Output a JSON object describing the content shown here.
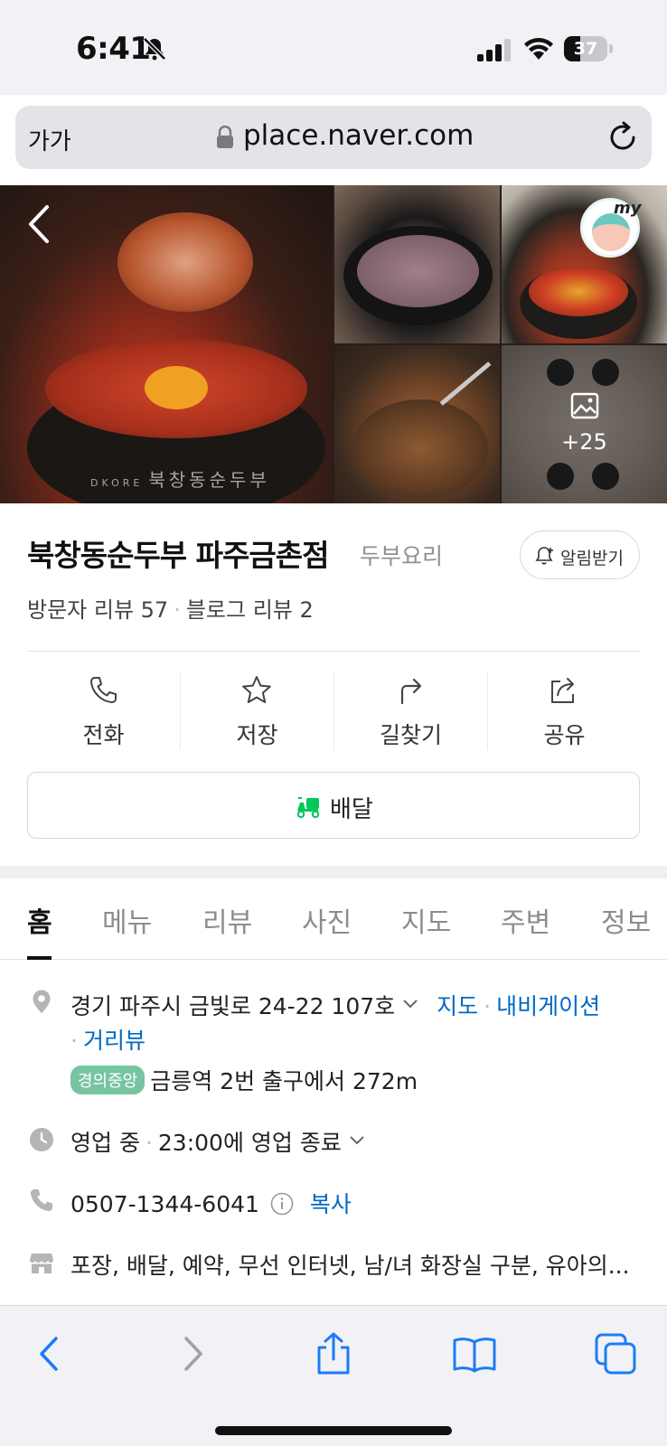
{
  "status_bar": {
    "time": "6:41",
    "battery": "37",
    "battery_level": 0.37
  },
  "browser": {
    "text_size_label": "가가",
    "url": "place.naver.com"
  },
  "photos": {
    "more_count": "+25",
    "pot_text": "북창동순두부",
    "pot_brand": "DKORE",
    "my_badge": "my"
  },
  "place": {
    "name": "북창동순두부 파주금촌점",
    "category": "두부요리",
    "notify_label": "알림받기",
    "visitor_reviews": "방문자 리뷰 57",
    "blog_reviews": "블로그 리뷰 2"
  },
  "actions": [
    {
      "label": "전화",
      "icon": "phone-icon"
    },
    {
      "label": "저장",
      "icon": "star-icon"
    },
    {
      "label": "길찾기",
      "icon": "directions-icon"
    },
    {
      "label": "공유",
      "icon": "share-icon"
    }
  ],
  "delivery": {
    "label": "배달",
    "icon": "delivery-scooter-icon",
    "color": "#03c75a"
  },
  "tabs": [
    "홈",
    "메뉴",
    "리뷰",
    "사진",
    "지도",
    "주변",
    "정보"
  ],
  "info": {
    "address": "경기 파주시 금빛로 24-22 107호",
    "map_link": "지도",
    "navigation_link": "내비게이션",
    "street_view_link": "거리뷰",
    "subway_line": "경의중앙",
    "subway_line_color": "#77c4a3",
    "subway_directions": "금릉역 2번 출구에서 272m",
    "business_status": "영업 중",
    "business_hours": "23:00에 영업 종료",
    "phone": "0507-1344-6041",
    "copy_link": "복사",
    "amenities": "포장, 배달, 예약, 무선 인터넷, 남/녀 화장실 구분, 유아의..."
  },
  "colors": {
    "link": "#0068c3",
    "accent_green": "#03c75a",
    "ios_blue": "#1a7cf5"
  }
}
